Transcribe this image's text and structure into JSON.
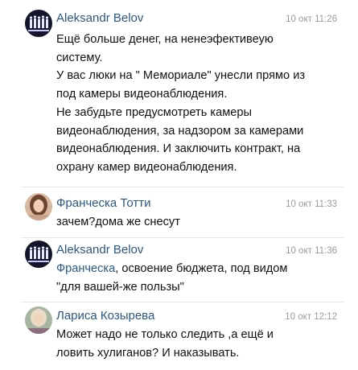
{
  "comments": [
    {
      "author": "Aleksandr Belov",
      "time": "10 окт 11:26",
      "avatar": "group-avatar-dark",
      "lines": [
        "Ещё больше денег, на ненеэфективеую",
        "систему.",
        "У вас люки на \" Мемориале\" унесли прямо из",
        "под камеры видеонаблюдения.",
        "Не забудьте предусмотреть камеры",
        "видеонаблюдения, за надзором за камерами",
        "видеонаблюдения. И заключить контракт, на",
        "охрану камер видеонаблюдения."
      ]
    },
    {
      "author": "Франческа Тотти",
      "time": "10 окт 11:33",
      "avatar": "woman-portrait-avatar",
      "lines": [
        "зачем?дома же снесут"
      ]
    },
    {
      "author": "Aleksandr Belov",
      "time": "10 окт 11:36",
      "avatar": "group-avatar-dark",
      "mention": "Франческа",
      "line1_rest": ", освоение бюджета, под видом",
      "lines": [
        "\"для вашей-же пользы\""
      ]
    },
    {
      "author": "Лариса Козырева",
      "time": "10 окт 12:12",
      "avatar": "woman-portrait-avatar",
      "lines": [
        "Может надо не только следить ,а ещё и",
        "ловить хулиганов? И наказывать."
      ]
    }
  ],
  "colors": {
    "author": "#2a5885",
    "time": "#9a9a9a",
    "divider": "#e4e6ea"
  }
}
